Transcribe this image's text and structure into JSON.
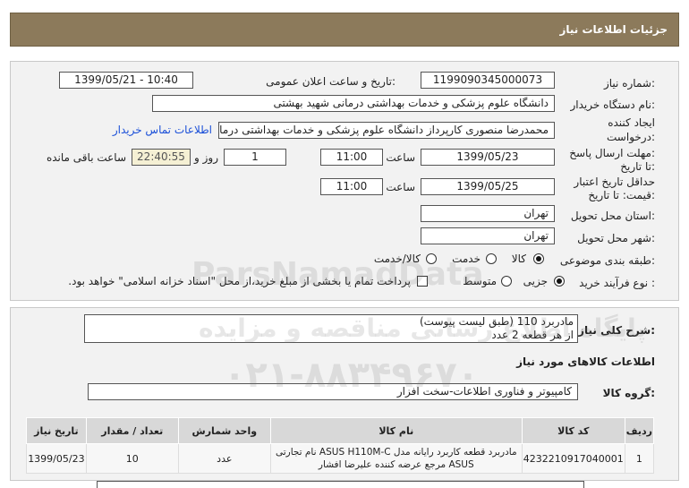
{
  "header": {
    "title": "جزئیات اطلاعات نیاز"
  },
  "details": {
    "need_number_label": "شماره نیاز:",
    "need_number": "1199090345000073",
    "announce_label": "تاریخ و ساعت اعلان عمومی:",
    "announce_value": "1399/05/21 - 10:40",
    "buyer_org_label": "نام دستگاه خریدار:",
    "buyer_org": "دانشگاه علوم پزشکی و خدمات بهداشتی درمانی شهید بهشتی",
    "creator_label_1": "ایجاد کننده",
    "creator_label_2": "درخواست:",
    "creator": "محمدرضا منصوری کارپرداز دانشگاه علوم پزشکی و خدمات بهداشتی درمانی شهید بهشتی",
    "contact_link": "اطلاعات تماس خریدار",
    "reply_deadline_label_1": "مهلت ارسال پاسخ:",
    "reply_deadline_label_2": "تا تاریخ:",
    "reply_date": "1399/05/23",
    "time_label": "ساعت",
    "reply_time": "11:00",
    "days_value": "1",
    "days_label": "روز و",
    "remaining_time": "22:40:55",
    "remaining_label": "ساعت باقی مانده",
    "validity_label_1": "حداقل تاریخ اعتبار",
    "validity_label_2": "قیمت: تا تاریخ:",
    "validity_date": "1399/05/25",
    "validity_time": "11:00",
    "province_label": "استان محل تحویل:",
    "province": "تهران",
    "city_label": "شهر محل تحویل:",
    "city": "تهران",
    "category_label": "طبقه بندی موضوعی:",
    "category_options": [
      "کالا",
      "خدمت",
      "کالا/خدمت"
    ],
    "category_selected": "کالا",
    "process_label": "نوع فرآیند خرید :",
    "process_options": [
      "جزیی",
      "متوسط"
    ],
    "process_selected": "جزیی",
    "payment_note": "پرداخت تمام یا بخشی از مبلغ خرید،از محل \"اسناد خزانه اسلامی\" خواهد بود."
  },
  "description": {
    "label": "شرح کلی نیاز:",
    "line1": "مادربرد 110 (طبق لیست پیوست)",
    "line2": "از هر قطعه 2 عدد"
  },
  "goods": {
    "section_title": "اطلاعات کالاهای مورد نیاز",
    "group_label": "گروه کالا:",
    "group_value": "کامپیوتر و فناوری اطلاعات-سخت افزار",
    "columns": [
      "ردیف",
      "کد کالا",
      "نام کالا",
      "واحد شمارش",
      "تعداد / مقدار",
      "تاریخ نیاز"
    ],
    "rows": [
      {
        "index": "1",
        "code": "4232210917040001",
        "name_line1": "مادربرد قطعه کاربرد رایانه مدل ASUS H110M-C نام تجارتی",
        "name_line2": "ASUS مرجع عرضه کننده علیرضا افشار",
        "unit": "عدد",
        "qty": "10",
        "date": "1399/05/23"
      }
    ]
  },
  "watermark": {
    "line1": "ParsNamadData",
    "line2": "پایگاه اطلاع رسانی مناقصه و مزایده",
    "line3": "۰۲۱-۸۸۳۴۹۶۷۰"
  }
}
